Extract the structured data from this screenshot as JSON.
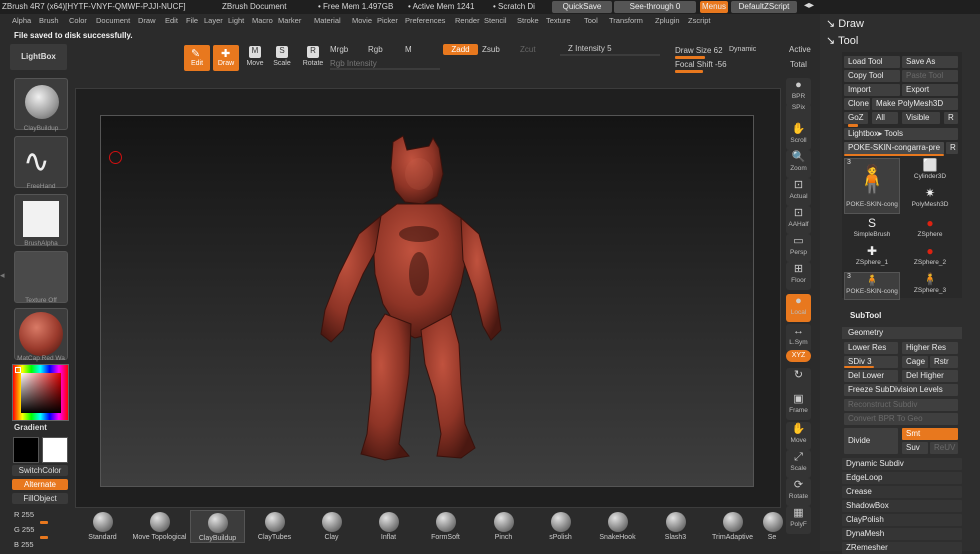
{
  "app": {
    "title_left": "ZBrush 4R7 (x64)[HYTF-VNYF-QMWF-PJJI-NUCF]",
    "doc_title": "ZBrush Document",
    "free_mem": "• Free Mem 1.497GB",
    "active_mem": "• Active Mem 1241",
    "scratch": "• Scratch Di",
    "quicksave": "QuickSave",
    "see_through": "See-through   0",
    "menus": "Menus",
    "default_zscript": "DefaultZScript"
  },
  "menu": [
    "Alpha",
    "Brush",
    "Color",
    "Document",
    "Draw",
    "Edit",
    "File",
    "Layer",
    "Light",
    "Macro",
    "Marker",
    "Material",
    "Movie",
    "Picker",
    "Preferences",
    "Render",
    "Stencil",
    "Stroke",
    "Texture",
    "Tool",
    "Transform",
    "Zplugin",
    "Zscript"
  ],
  "status": "File saved to disk successfully.",
  "toolbar": {
    "lightbox": "LightBox",
    "edit": "Edit",
    "draw": "Draw",
    "move": "Move",
    "scale": "Scale",
    "rotate": "Rotate",
    "mrgb": "Mrgb",
    "rgb": "Rgb",
    "m": "M",
    "rgb_intensity": "Rgb Intensity",
    "zadd": "Zadd",
    "zsub": "Zsub",
    "zcut": "Zcut",
    "z_intensity": "Z Intensity 5",
    "draw_size": "Draw Size 62",
    "dynamic": "Dynamic",
    "active": "Active",
    "focal_shift": "Focal Shift -56",
    "total": "Total"
  },
  "left": {
    "brush": "ClayBuildup",
    "stroke": "FreeHand",
    "alpha": "BrushAlpha",
    "texture": "Texture Off",
    "material": "MatCap Red Wa",
    "gradient": "Gradient",
    "switchcolor": "SwitchColor",
    "alternate": "Alternate",
    "fillobject": "FillObject",
    "r": "R 255",
    "g": "G 255",
    "b": "B 255"
  },
  "rightbar": [
    {
      "label": "BPR",
      "icon": "●"
    },
    {
      "label": "SPix",
      "icon": ""
    },
    {
      "label": "Scroll",
      "icon": "✋"
    },
    {
      "label": "Zoom",
      "icon": "🔍"
    },
    {
      "label": "Actual",
      "icon": "⊡"
    },
    {
      "label": "AAHalf",
      "icon": "⊡"
    },
    {
      "label": "Persp",
      "icon": "▭"
    },
    {
      "label": "Floor",
      "icon": "⊞"
    },
    {
      "label": "Local",
      "icon": "●"
    },
    {
      "label": "L.Sym",
      "icon": "↔"
    },
    {
      "label": "XYZ",
      "icon": ""
    },
    {
      "label": "",
      "icon": "↻"
    },
    {
      "label": "Frame",
      "icon": "▣"
    },
    {
      "label": "Move",
      "icon": "✋"
    },
    {
      "label": "Scale",
      "icon": "⤢"
    },
    {
      "label": "Rotate",
      "icon": "⟳"
    },
    {
      "label": "PolyF",
      "icon": "▦"
    }
  ],
  "shelf": [
    "Standard",
    "Move Topological",
    "ClayBuildup",
    "ClayTubes",
    "Clay",
    "Inflat",
    "FormSoft",
    "Pinch",
    "sPolish",
    "SnakeHook",
    "Slash3",
    "TrimAdaptive",
    "Se"
  ],
  "tray": {
    "draw": "Draw",
    "tool": "Tool",
    "load_tool": "Load Tool",
    "save_as": "Save As",
    "copy_tool": "Copy Tool",
    "paste_tool": "Paste Tool",
    "import": "Import",
    "export": "Export",
    "clone": "Clone",
    "make_polymesh": "Make PolyMesh3D",
    "goz": "GoZ",
    "all": "All",
    "visible": "Visible",
    "r": "R",
    "lightbox_tools": "Lightbox▸ Tools",
    "current_tool": "POKE-SKIN-congarra-pre",
    "tool_r": "R",
    "tools": [
      {
        "name": "POKE-SKIN-cong",
        "count": "3"
      },
      {
        "name": "Cylinder3D",
        "count": ""
      },
      {
        "name": "PolyMesh3D",
        "count": ""
      },
      {
        "name": "SimpleBrush",
        "count": ""
      },
      {
        "name": "ZSphere",
        "count": ""
      },
      {
        "name": "ZSphere_1",
        "count": ""
      },
      {
        "name": "ZSphere_2",
        "count": ""
      },
      {
        "name": "POKE-SKIN-cong",
        "count": "3"
      },
      {
        "name": "ZSphere_3",
        "count": ""
      }
    ],
    "subtool": "SubTool",
    "geometry": "Geometry",
    "lower_res": "Lower Res",
    "higher_res": "Higher Res",
    "sdiv": "SDiv 3",
    "cage": "Cage",
    "rstr": "Rstr",
    "del_lower": "Del Lower",
    "del_higher": "Del Higher",
    "freeze": "Freeze SubDivision Levels",
    "reconstruct": "Reconstruct Subdiv",
    "convert_bpr": "Convert BPR To Geo",
    "divide": "Divide",
    "smt": "Smt",
    "suv": "Suv",
    "reuv": "ReUV",
    "dynamic_subdiv": "Dynamic Subdiv",
    "edgeloop": "EdgeLoop",
    "crease": "Crease",
    "shadowbox": "ShadowBox",
    "claypolish": "ClayPolish",
    "dynamesh": "DynaMesh",
    "zremesher": "ZRemesher"
  },
  "colors": {
    "accent": "#e8781e",
    "model": "#9a3a2c"
  }
}
